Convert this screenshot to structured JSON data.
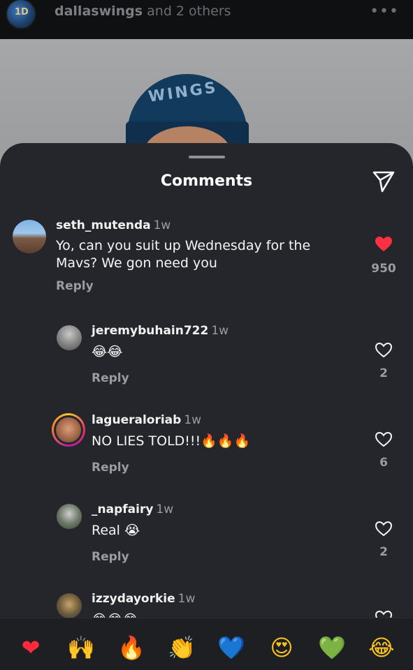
{
  "post": {
    "owner": "dallaswings",
    "others": "and 2 others",
    "avatar_text": "1D",
    "cap_text": "WINGS"
  },
  "sheet": {
    "title": "Comments"
  },
  "comments": [
    {
      "username": "seth_mutenda",
      "time": "1w",
      "text": "Yo, can you suit up Wednesday for the Mavs? We gon need you",
      "reply": "Reply",
      "likes": "950",
      "liked": true
    },
    {
      "username": "jeremybuhain722",
      "time": "1w",
      "text": "😂😂",
      "reply": "Reply",
      "likes": "2",
      "liked": false
    },
    {
      "username": "lagueraloriab",
      "time": "1w",
      "text": "NO LIES TOLD!!!🔥🔥🔥",
      "reply": "Reply",
      "likes": "6",
      "liked": false
    },
    {
      "username": "_napfairy",
      "time": "1w",
      "text": "Real 😭",
      "reply": "Reply",
      "likes": "2",
      "liked": false
    },
    {
      "username": "izzydayorkie",
      "time": "1w",
      "text": "😂😂😂",
      "reply": "",
      "likes": "",
      "liked": false
    }
  ],
  "quick_reactions": [
    {
      "name": "red-heart-emoji",
      "glyph": "❤"
    },
    {
      "name": "raising-hands-emoji",
      "glyph": "🙌"
    },
    {
      "name": "fire-emoji",
      "glyph": "🔥"
    },
    {
      "name": "clapping-hands-emoji",
      "glyph": "👏"
    },
    {
      "name": "blue-heart-emoji",
      "glyph": "💙"
    },
    {
      "name": "heart-eyes-emoji",
      "glyph": "😍"
    },
    {
      "name": "green-heart-emoji",
      "glyph": "💚"
    },
    {
      "name": "tears-of-joy-emoji",
      "glyph": "😂"
    }
  ],
  "colors": {
    "sheet_bg": "#25262b",
    "like_red": "#ff3040",
    "muted_text": "#9a9ca2"
  }
}
